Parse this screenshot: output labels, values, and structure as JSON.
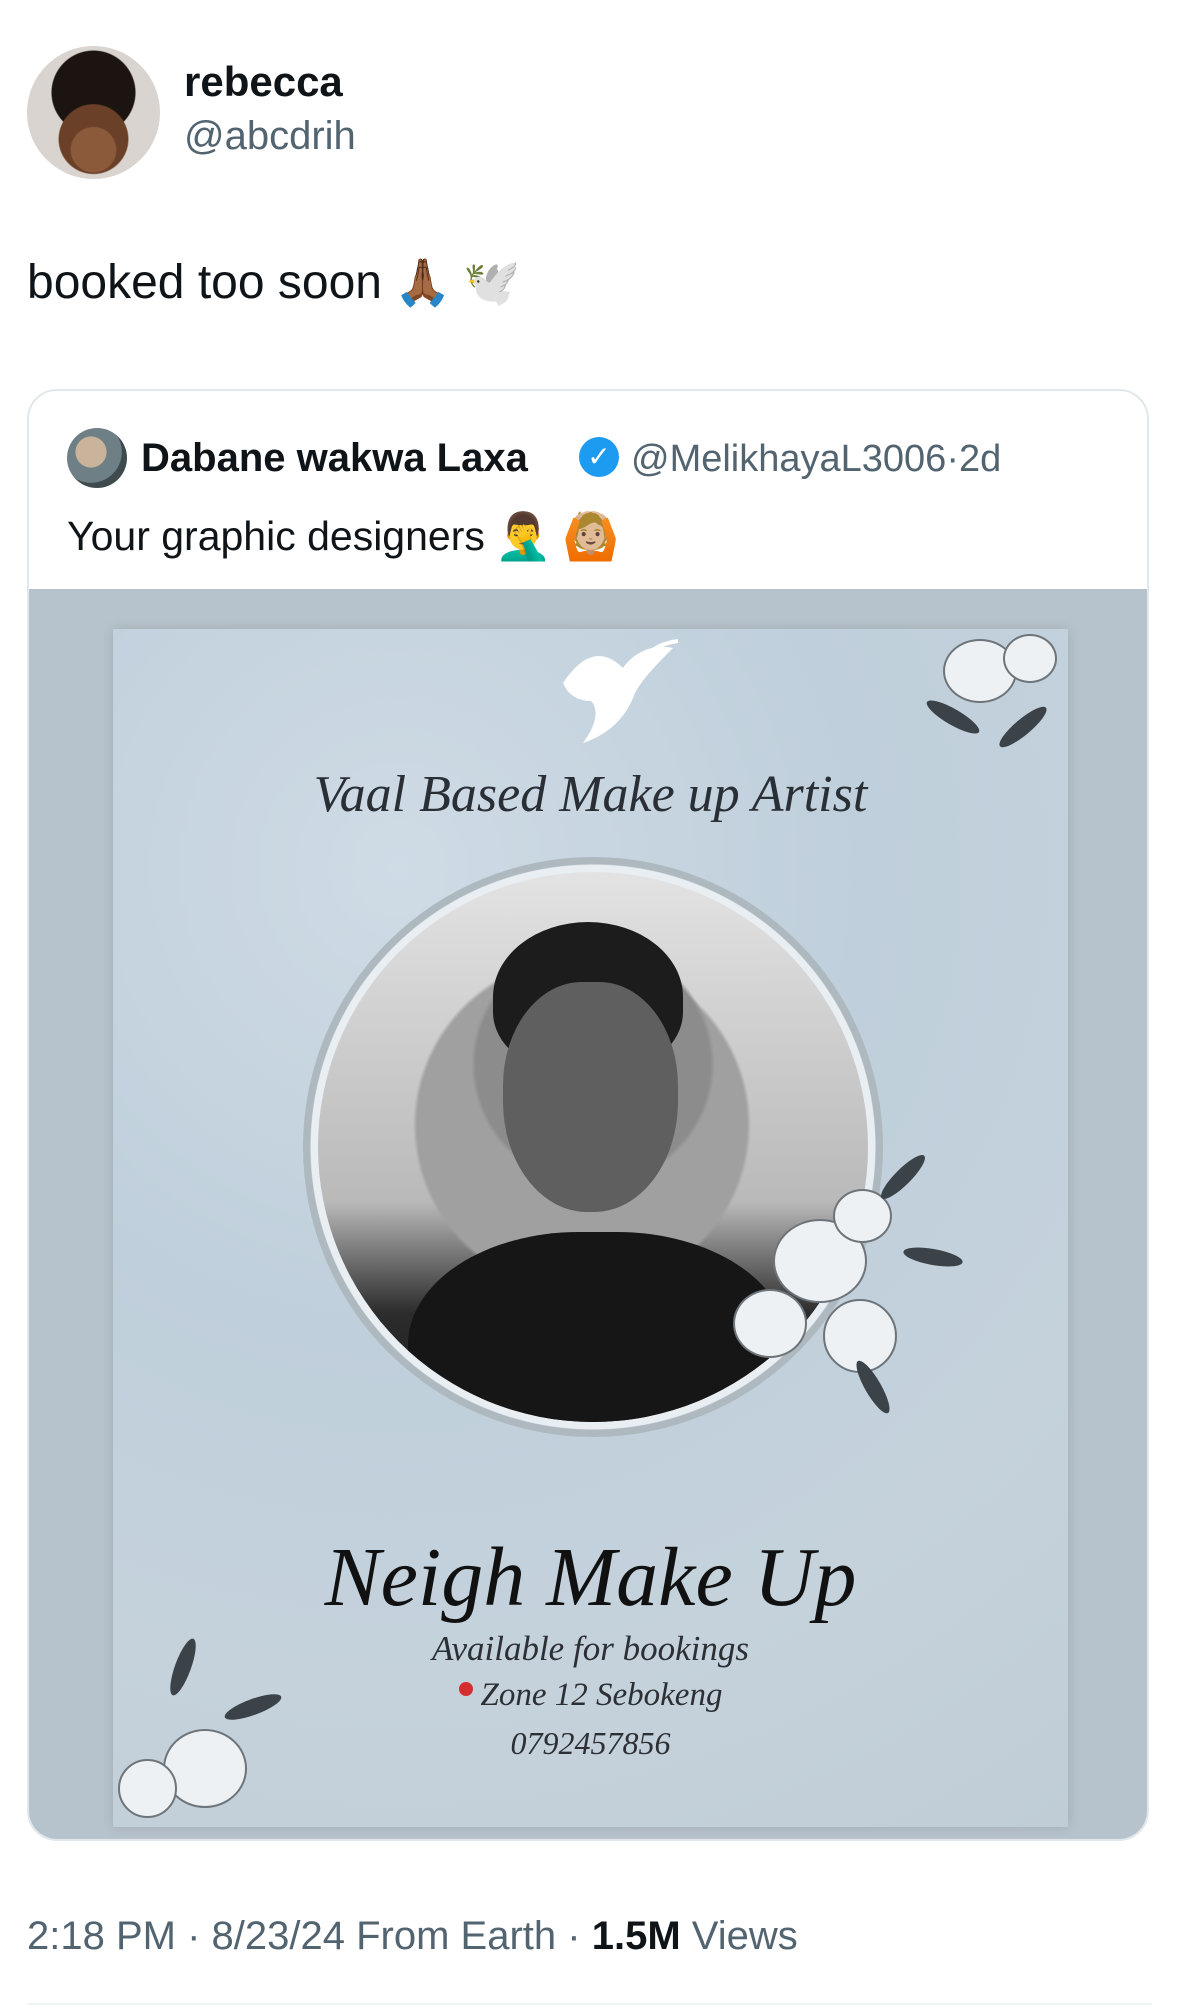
{
  "tweet": {
    "author": {
      "display_name": "rebecca",
      "handle": "@abcdrih"
    },
    "text": "booked too soon",
    "text_emojis": [
      "🙏🏾",
      "🕊️"
    ],
    "meta": {
      "time": "2:18 PM",
      "date": "8/23/24",
      "source": "From Earth",
      "views_count": "1.5M",
      "views_label": "Views"
    }
  },
  "quote": {
    "author": {
      "display_name": "Dabane wakwa Laxa",
      "handle": "@MelikhayaL3006",
      "age": "2d"
    },
    "text": "Your graphic designers",
    "text_emojis": [
      "🤦‍♂️",
      "🙆🏼"
    ]
  },
  "flyer": {
    "headline": "Vaal Based Make up Artist",
    "brand": "Neigh Make Up",
    "availability": "Available for bookings",
    "location": "Zone 12 Sebokeng",
    "phone": "0792457856"
  },
  "colors": {
    "verified": "#1d9bf0",
    "secondary_text": "#536471",
    "flyer_bg": "#c2d0db"
  },
  "icons": [
    "verified-badge-icon",
    "dove-icon",
    "location-pin-icon",
    "flower-decoration"
  ]
}
